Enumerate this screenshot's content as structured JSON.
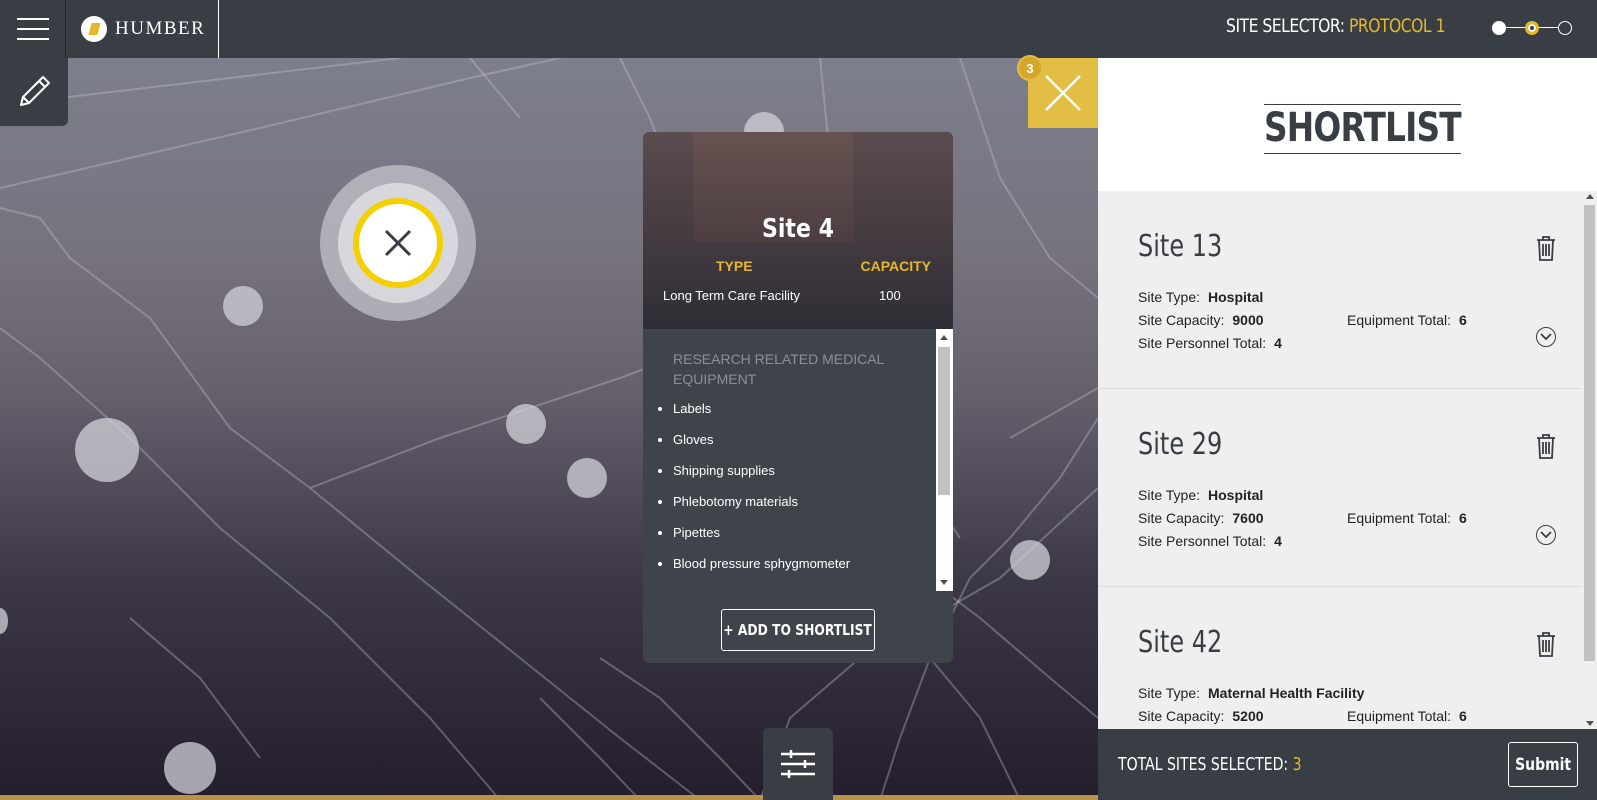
{
  "header": {
    "logo_text": "HUMBER",
    "site_selector_label": "SITE SELECTOR:",
    "protocol": "PROTOCOL 1"
  },
  "popup": {
    "title": "Site 4",
    "type_header": "TYPE",
    "capacity_header": "CAPACITY",
    "type_value": "Long Term Care Facility",
    "capacity_value": "100",
    "equipment_heading": "RESEARCH RELATED MEDICAL EQUIPMENT",
    "equipment": [
      "Labels",
      "Gloves",
      "Shipping supplies",
      "Phlebotomy materials",
      "Pipettes",
      "Blood pressure sphygmometer"
    ],
    "add_button": "+ ADD TO SHORTLIST"
  },
  "close_badge": "3",
  "shortlist": {
    "title": "SHORTLIST",
    "labels": {
      "type": "Site Type:",
      "capacity": "Site Capacity:",
      "personnel": "Site Personnel Total:",
      "equipment": "Equipment Total:"
    },
    "cards": [
      {
        "name": "Site 13",
        "type": "Hospital",
        "capacity": "9000",
        "personnel": "4",
        "equipment": "6"
      },
      {
        "name": "Site 29",
        "type": "Hospital",
        "capacity": "7600",
        "personnel": "4",
        "equipment": "6"
      },
      {
        "name": "Site 42",
        "type": "Maternal Health Facility",
        "capacity": "5200",
        "personnel": "",
        "equipment": "6"
      }
    ],
    "total_label": "TOTAL SITES SELECTED:",
    "total_value": "3",
    "submit": "Submit"
  }
}
